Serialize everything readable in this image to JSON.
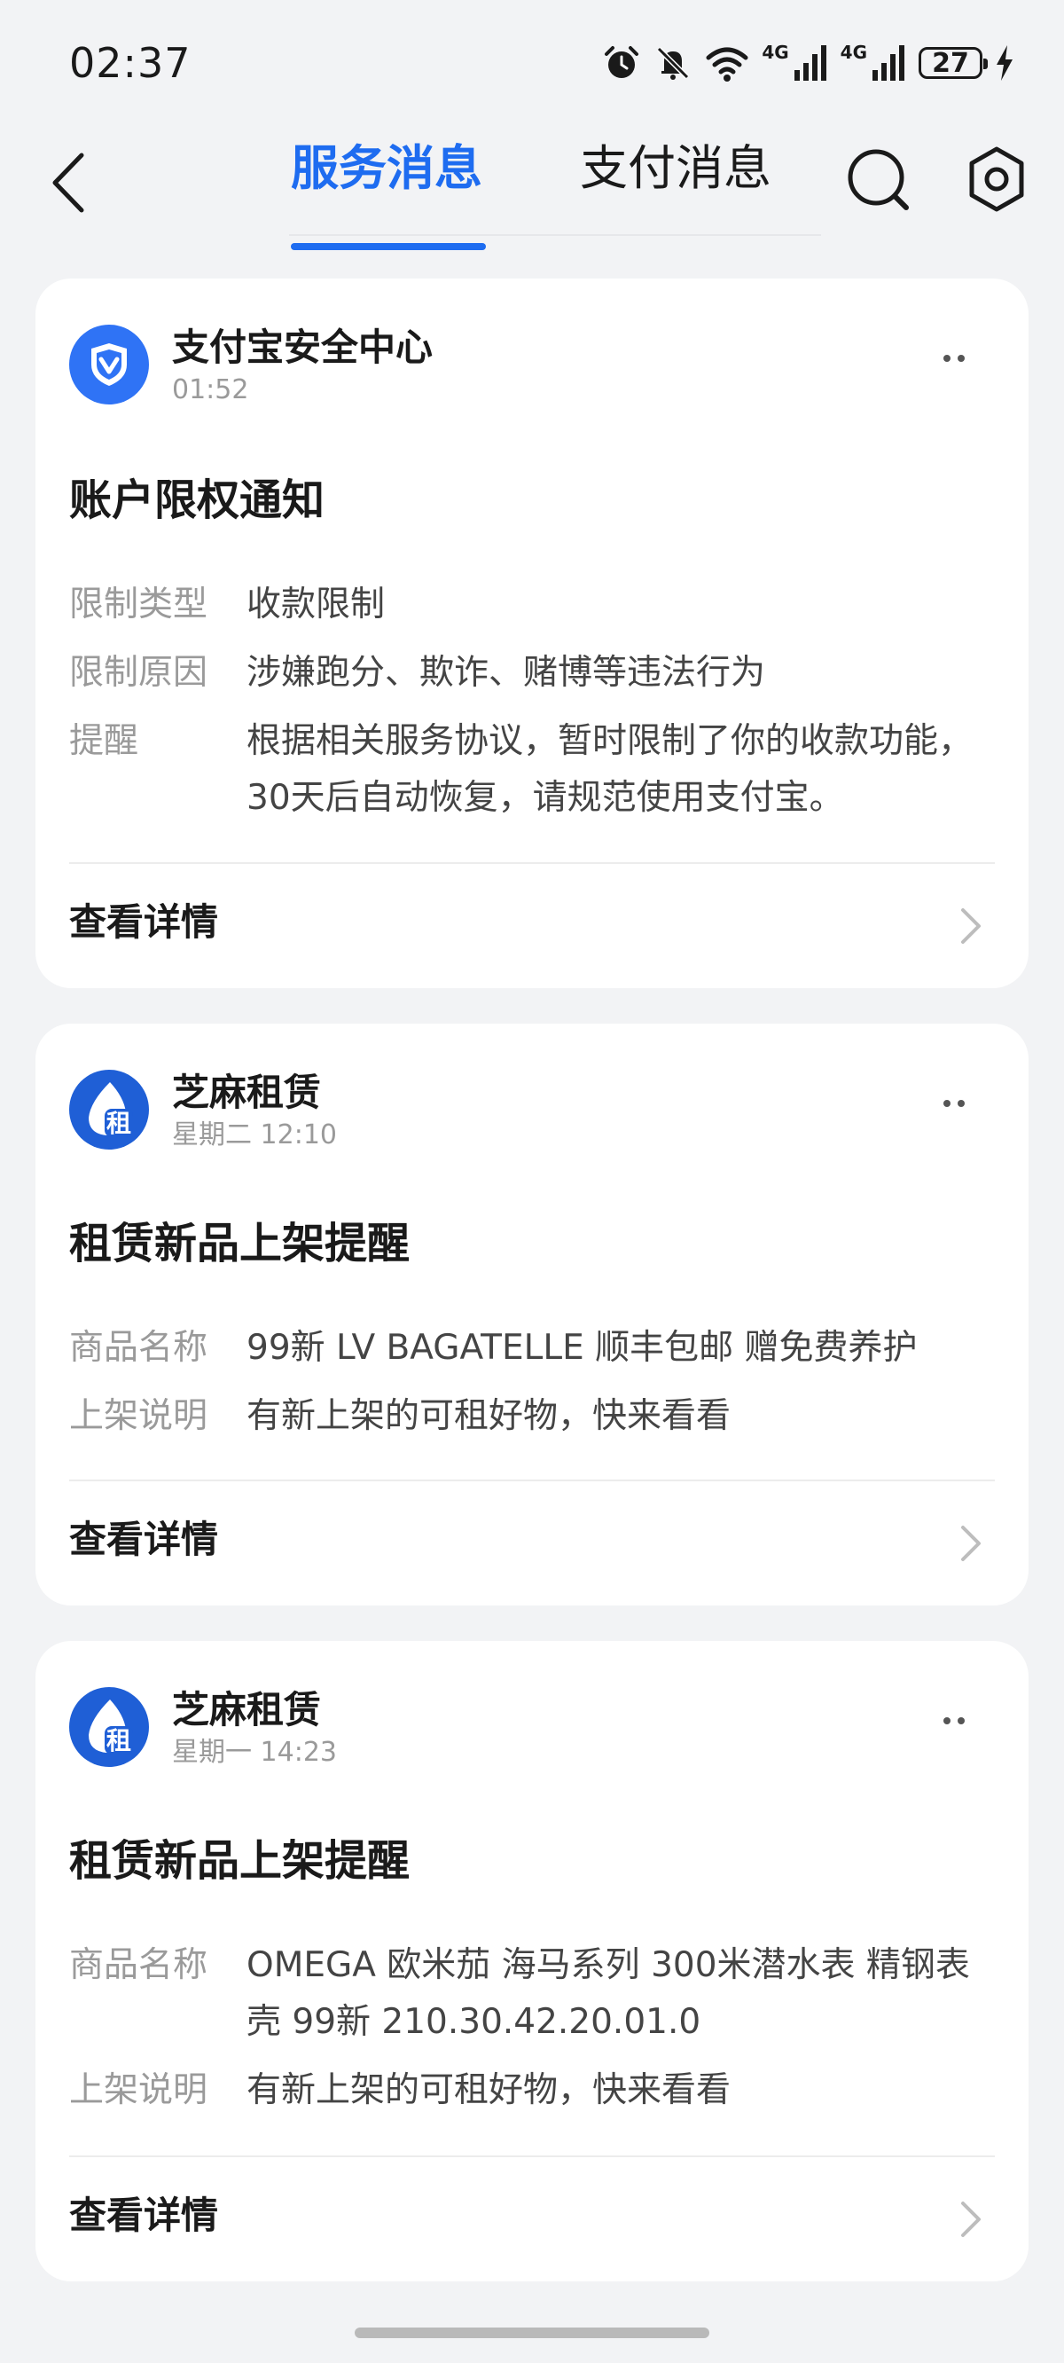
{
  "status_bar": {
    "time": "02:37",
    "net1": "4G",
    "net2": "4G",
    "battery": "27",
    "icons": [
      "alarm-icon",
      "mute-bell-icon",
      "wifi-icon",
      "signal-icon",
      "signal-icon",
      "battery-icon",
      "charging-icon"
    ]
  },
  "nav": {
    "back_icon": "chevron-left-icon",
    "tabs": [
      {
        "label": "服务消息",
        "active": true
      },
      {
        "label": "支付消息",
        "active": false
      }
    ],
    "search_icon": "search-icon",
    "settings_icon": "gear-icon"
  },
  "colors": {
    "accent": "#1e6cf0",
    "background": "#f2f3f5",
    "card": "#ffffff",
    "muted": "#9a9a9a"
  },
  "cards": [
    {
      "sender": "支付宝安全中心",
      "time": "01:52",
      "avatar_icon": "shield-icon",
      "title": "账户限权通知",
      "fields": [
        {
          "label": "限制类型",
          "value": "收款限制"
        },
        {
          "label": "限制原因",
          "value": "涉嫌跑分、欺诈、赌博等违法行为"
        },
        {
          "label": "提醒",
          "value": "根据相关服务协议，暂时限制了你的收款功能，30天后自动恢复，请规范使用支付宝。"
        }
      ],
      "detail_label": "查看详情"
    },
    {
      "sender": "芝麻租赁",
      "time": "星期二 12:10",
      "avatar_icon": "zhima-rental-icon",
      "avatar_char": "租",
      "title": "租赁新品上架提醒",
      "fields": [
        {
          "label": "商品名称",
          "value": "99新 LV BAGATELLE  顺丰包邮 赠免费养护"
        },
        {
          "label": "上架说明",
          "value": "有新上架的可租好物，快来看看"
        }
      ],
      "detail_label": "查看详情"
    },
    {
      "sender": "芝麻租赁",
      "time": "星期一 14:23",
      "avatar_icon": "zhima-rental-icon",
      "avatar_char": "租",
      "title": "租赁新品上架提醒",
      "fields": [
        {
          "label": "商品名称",
          "value": "OMEGA 欧米茄 海马系列 300米潜水表 精钢表壳 99新  210.30.42.20.01.0"
        },
        {
          "label": "上架说明",
          "value": "有新上架的可租好物，快来看看"
        }
      ],
      "detail_label": "查看详情"
    }
  ]
}
